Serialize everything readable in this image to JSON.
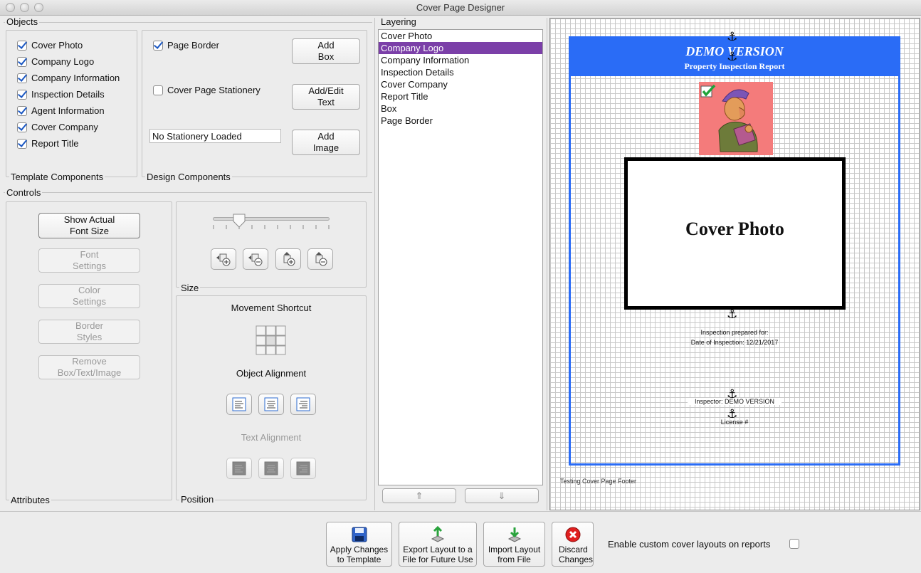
{
  "window": {
    "title": "Cover Page Designer"
  },
  "objects": {
    "group_label": "Objects",
    "template": {
      "label": "Template Components",
      "items": [
        {
          "label": "Cover Photo",
          "checked": true
        },
        {
          "label": "Company Logo",
          "checked": true
        },
        {
          "label": "Company Information",
          "checked": true
        },
        {
          "label": "Inspection Details",
          "checked": true
        },
        {
          "label": "Agent Information",
          "checked": true
        },
        {
          "label": "Cover Company",
          "checked": true
        },
        {
          "label": "Report Title",
          "checked": true
        }
      ]
    },
    "design": {
      "label": "Design Components",
      "page_border": {
        "label": "Page Border",
        "checked": true
      },
      "stationery": {
        "label": "Cover Page Stationery",
        "checked": false
      },
      "stationery_field": "No Stationery Loaded",
      "add_box": "Add Box",
      "add_edit_text": "Add/Edit Text",
      "add_image": "Add Image"
    }
  },
  "controls": {
    "group_label": "Controls",
    "attributes": {
      "label": "Attributes",
      "show_actual_font": "Show Actual Font Size",
      "font_settings": "Font Settings",
      "color_settings": "Color Settings",
      "border_styles": "Border Styles",
      "remove": "Remove Box/Text/Image"
    },
    "size": {
      "label": "Size",
      "slider_value_fraction": 0.2
    },
    "position": {
      "label": "Position",
      "movement_shortcut": "Movement Shortcut",
      "object_alignment": "Object Alignment",
      "text_alignment": "Text Alignment"
    }
  },
  "layering": {
    "label": "Layering",
    "items": [
      "Cover Photo",
      "Company Logo",
      "Company Information",
      "Inspection Details",
      "Cover Company",
      "Report Title",
      "Box",
      "Page Border"
    ],
    "selected": "Company Logo",
    "up_arrow": "⇑",
    "down_arrow": "⇓"
  },
  "preview": {
    "demo_title": "DEMO VERSION",
    "report_title": "Property Inspection Report",
    "cover_photo_label": "Cover Photo",
    "prepared_for": "Inspection prepared for:",
    "date_of_inspection": "Date of Inspection: 12/21/2017",
    "inspector": "Inspector: DEMO VERSION",
    "license": "License #",
    "footer": "Testing Cover Page Footer",
    "header_color": "#2a6cf6",
    "logo_bg_color": "#f47b7b"
  },
  "footer": {
    "apply": "Apply Changes to Template",
    "export": "Export Layout to a File for Future Use",
    "import": "Import Layout from File",
    "discard": "Discard Changes",
    "enable_custom": "Enable custom cover layouts on reports",
    "enable_checked": false
  }
}
